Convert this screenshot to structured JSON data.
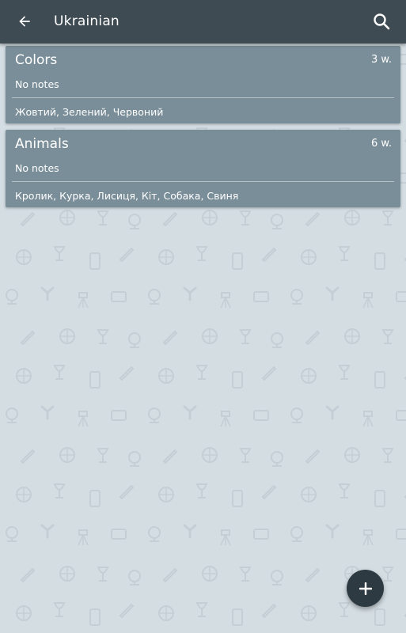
{
  "colors": {
    "app_bar": "#3f4b53",
    "card": "#7a8e99",
    "background": "#d3dde2",
    "fab": "#2e3a42"
  },
  "header": {
    "back_icon": "arrow-back-icon",
    "title": "Ukrainian",
    "search_icon": "search-icon"
  },
  "cards": [
    {
      "title": "Colors",
      "count": "3 w.",
      "notes": "No notes",
      "words": "Жовтий, Зелений, Червоний"
    },
    {
      "title": "Animals",
      "count": "6 w.",
      "notes": "No notes",
      "words": "Кролик, Курка, Лисиця, Кіт, Собака, Свиня"
    }
  ],
  "fab": {
    "icon": "plus-icon"
  }
}
